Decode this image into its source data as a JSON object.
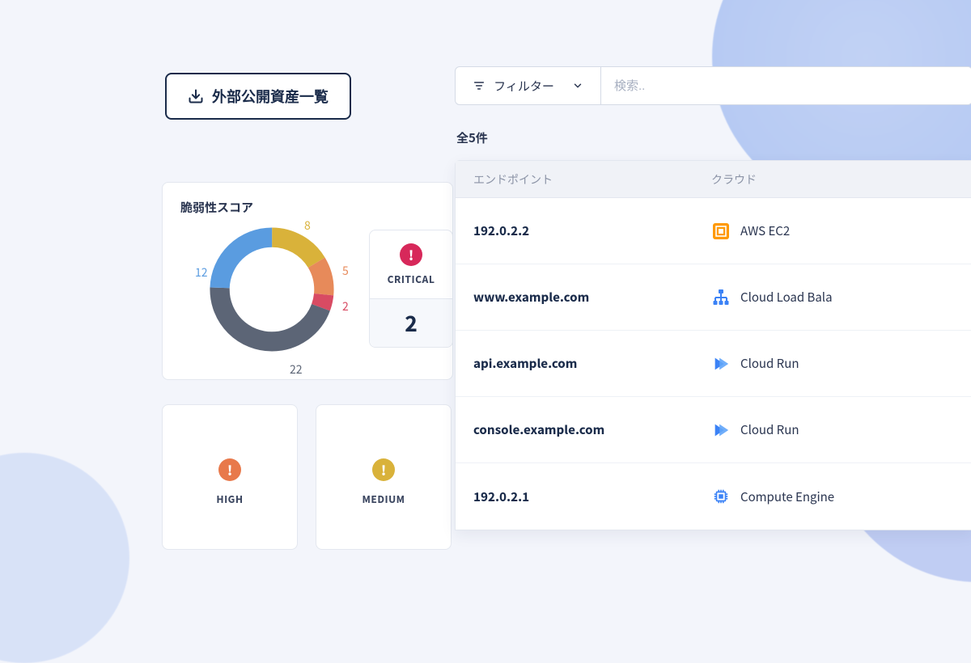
{
  "download_button_label": "外部公開資産一覧",
  "filter_label": "フィルター",
  "search_placeholder": "検索..",
  "count_text": "全5件",
  "score_card_title": "脆弱性スコア",
  "critical": {
    "label": "CRITICAL",
    "value": "2"
  },
  "severities": {
    "high": "HIGH",
    "medium": "MEDIUM"
  },
  "table": {
    "headers": {
      "endpoint": "エンドポイント",
      "cloud": "クラウド"
    },
    "rows": [
      {
        "endpoint": "192.0.2.2",
        "cloud": "AWS EC2",
        "icon": "aws"
      },
      {
        "endpoint": "www.example.com",
        "cloud": "Cloud Load Bala",
        "icon": "lb"
      },
      {
        "endpoint": "api.example.com",
        "cloud": "Cloud Run",
        "icon": "run"
      },
      {
        "endpoint": "console.example.com",
        "cloud": "Cloud Run",
        "icon": "run"
      },
      {
        "endpoint": "192.0.2.1",
        "cloud": "Compute Engine",
        "icon": "gce"
      }
    ]
  },
  "chart_data": {
    "type": "donut",
    "title": "脆弱性スコア",
    "series": [
      {
        "name": "yellow",
        "value": 8,
        "color": "#d9b23a"
      },
      {
        "name": "orange",
        "value": 5,
        "color": "#e78a5a"
      },
      {
        "name": "red",
        "value": 2,
        "color": "#d84b63"
      },
      {
        "name": "gray",
        "value": 22,
        "color": "#5c6576"
      },
      {
        "name": "blue",
        "value": 12,
        "color": "#5a9ce0"
      }
    ]
  }
}
